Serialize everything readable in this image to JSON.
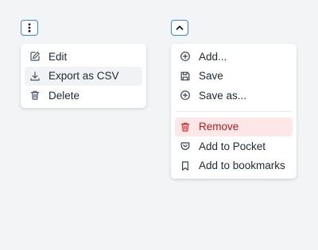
{
  "left_menu": {
    "items": [
      {
        "label": "Edit",
        "icon": "edit-icon"
      },
      {
        "label": "Export as CSV",
        "icon": "download-icon"
      },
      {
        "label": "Delete",
        "icon": "trash-icon"
      }
    ]
  },
  "right_menu": {
    "items": [
      {
        "label": "Add...",
        "icon": "plus-circle-icon"
      },
      {
        "label": "Save",
        "icon": "save-icon"
      },
      {
        "label": "Save as...",
        "icon": "plus-circle-icon"
      },
      {
        "label": "Remove",
        "icon": "trash-icon"
      },
      {
        "label": "Add to Pocket",
        "icon": "pocket-icon"
      },
      {
        "label": "Add to bookmarks",
        "icon": "bookmark-icon"
      }
    ]
  },
  "colors": {
    "accent": "#3b82f6",
    "danger_text": "#b91c1c",
    "danger_bg": "#fde7e9",
    "hover_bg": "#f1f2f4"
  }
}
